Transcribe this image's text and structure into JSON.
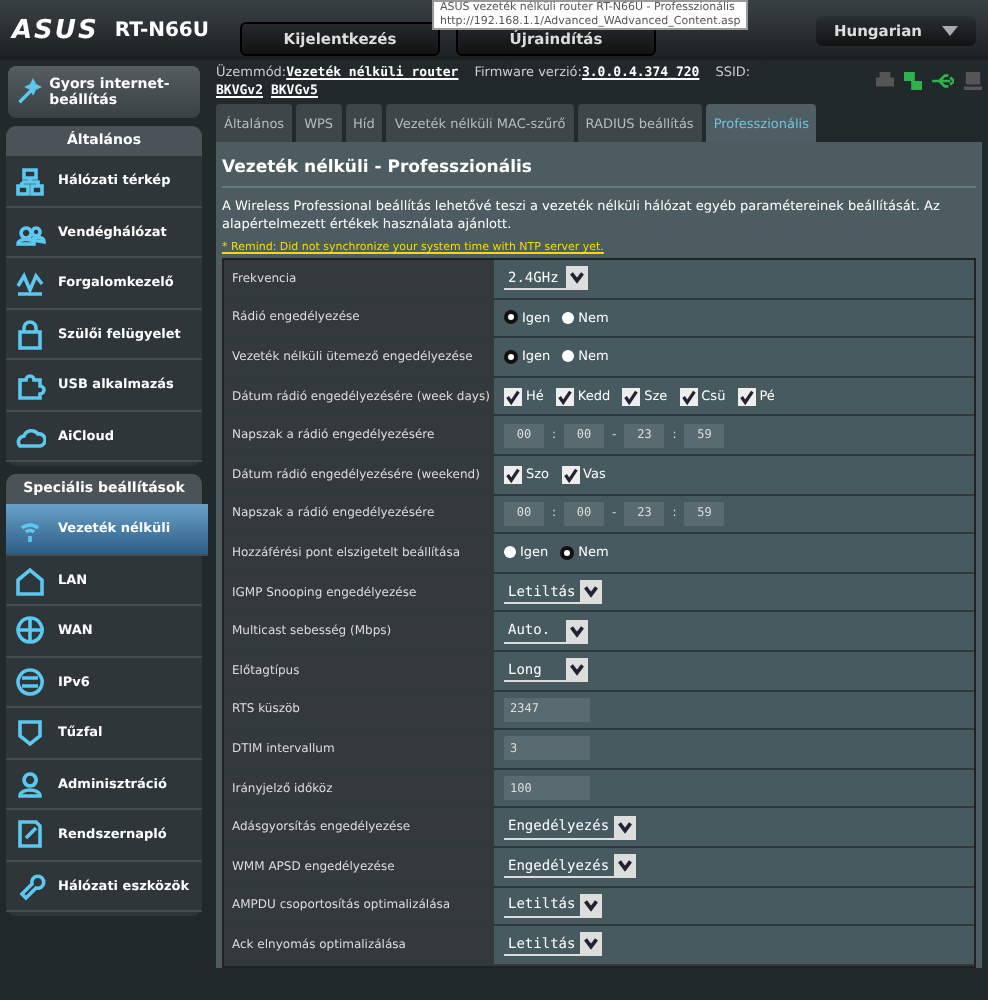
{
  "header": {
    "brand": "ASUS",
    "model": "RT-N66U",
    "buttons": [
      "Kijelentkezés",
      "Újraindítás"
    ],
    "language": "Hungarian",
    "tooltip": {
      "title": "ASUS vezeték nélküli router RT-N66U - Professzionális",
      "url": "http://192.168.1.1/Advanced_WAdvanced_Content.asp"
    }
  },
  "sidebar": {
    "quick_setup": "Gyors internet-beállítás",
    "sections": [
      {
        "title": "Általános",
        "items": [
          {
            "label": "Hálózati térkép",
            "selected": false
          },
          {
            "label": "Vendéghálózat",
            "selected": false
          },
          {
            "label": "Forgalomkezelő",
            "selected": false
          },
          {
            "label": "Szülői felügyelet",
            "selected": false
          },
          {
            "label": "USB alkalmazás",
            "selected": false
          },
          {
            "label": "AiCloud",
            "selected": false
          }
        ]
      },
      {
        "title": "Speciális beállítások",
        "items": [
          {
            "label": "Vezeték nélküli",
            "selected": true
          },
          {
            "label": "LAN",
            "selected": false
          },
          {
            "label": "WAN",
            "selected": false
          },
          {
            "label": "IPv6",
            "selected": false
          },
          {
            "label": "Tűzfal",
            "selected": false
          },
          {
            "label": "Adminisztráció",
            "selected": false
          },
          {
            "label": "Rendszernapló",
            "selected": false
          },
          {
            "label": "Hálózati eszközök",
            "selected": false
          }
        ]
      }
    ]
  },
  "status": {
    "mode_label": "Üzemmód:",
    "mode": "Vezeték nélküli router",
    "firmware_label": "Firmware verzió:",
    "firmware": "3.0.0.4.374_720",
    "ssid_label": "SSID:",
    "ssids": [
      "BKVGv2",
      "BKVGv5"
    ]
  },
  "tabs": [
    {
      "label": "Általános",
      "selected": false
    },
    {
      "label": "WPS",
      "selected": false
    },
    {
      "label": "Híd",
      "selected": false
    },
    {
      "label": "Vezeték nélküli MAC-szűrő",
      "selected": false
    },
    {
      "label": "RADIUS beállítás",
      "selected": false
    },
    {
      "label": "Professzionális",
      "selected": true
    }
  ],
  "panel": {
    "title": "Vezeték nélküli - Professzionális",
    "description": "A Wireless Professional beállítás lehetővé teszi a vezeték nélküli hálózat egyéb paramétereinek beállítását. Az alapértelmezett értékek használata ajánlott.",
    "warning": "* Remind: Did not synchronize your system time with NTP server yet.",
    "settings": [
      {
        "label": "Frekvencia",
        "kind": "select",
        "value": "2.4GHz"
      },
      {
        "label": "Rádió engedélyezése",
        "kind": "radio",
        "options": [
          {
            "label": "Igen",
            "selected": true
          },
          {
            "label": "Nem",
            "selected": false
          }
        ]
      },
      {
        "label": "Vezeték nélküli ütemező engedélyezése",
        "kind": "radio",
        "options": [
          {
            "label": "Igen",
            "selected": true
          },
          {
            "label": "Nem",
            "selected": false
          }
        ]
      },
      {
        "label": "Dátum rádió engedélyezésére (week days)",
        "kind": "checks",
        "options": [
          {
            "label": "Hé",
            "checked": true
          },
          {
            "label": "Kedd",
            "checked": true
          },
          {
            "label": "Sze",
            "checked": true
          },
          {
            "label": "Csü",
            "checked": true
          },
          {
            "label": "Pé",
            "checked": true
          }
        ]
      },
      {
        "label": "Napszak a rádió engedélyezésére",
        "kind": "time",
        "parts": [
          "00",
          "00",
          "23",
          "59"
        ],
        "separators": [
          ":",
          "-",
          ":"
        ]
      },
      {
        "label": "Dátum rádió engedélyezésére (weekend)",
        "kind": "checks",
        "options": [
          {
            "label": "Szo",
            "checked": true
          },
          {
            "label": "Vas",
            "checked": true
          }
        ]
      },
      {
        "label": "Napszak a rádió engedélyezésére",
        "kind": "time",
        "parts": [
          "00",
          "00",
          "23",
          "59"
        ],
        "separators": [
          ":",
          "-",
          ":"
        ]
      },
      {
        "label": "Hozzáférési pont elszigetelt beállítása",
        "kind": "radio",
        "options": [
          {
            "label": "Igen",
            "selected": false
          },
          {
            "label": "Nem",
            "selected": true
          }
        ]
      },
      {
        "label": "IGMP Snooping engedélyezése",
        "kind": "select",
        "value": "Letiltás"
      },
      {
        "label": "Multicast sebesség (Mbps)",
        "kind": "select",
        "value": "Auto."
      },
      {
        "label": "Előtagtípus",
        "kind": "select",
        "value": "Long"
      },
      {
        "label": "RTS küszöb",
        "kind": "text",
        "value": "2347"
      },
      {
        "label": "DTIM intervallum",
        "kind": "text",
        "value": "3"
      },
      {
        "label": "Irányjelző időköz",
        "kind": "text",
        "value": "100"
      },
      {
        "label": "Adásgyorsítás engedélyezése",
        "kind": "select",
        "value": "Engedélyezés"
      },
      {
        "label": "WMM APSD engedélyezése",
        "kind": "select",
        "value": "Engedélyezés"
      },
      {
        "label": "AMPDU csoportosítás optimalizálása",
        "kind": "select",
        "value": "Letiltás"
      },
      {
        "label": "Ack elnyomás optimalizálása",
        "kind": "select",
        "value": "Letiltás"
      }
    ]
  }
}
